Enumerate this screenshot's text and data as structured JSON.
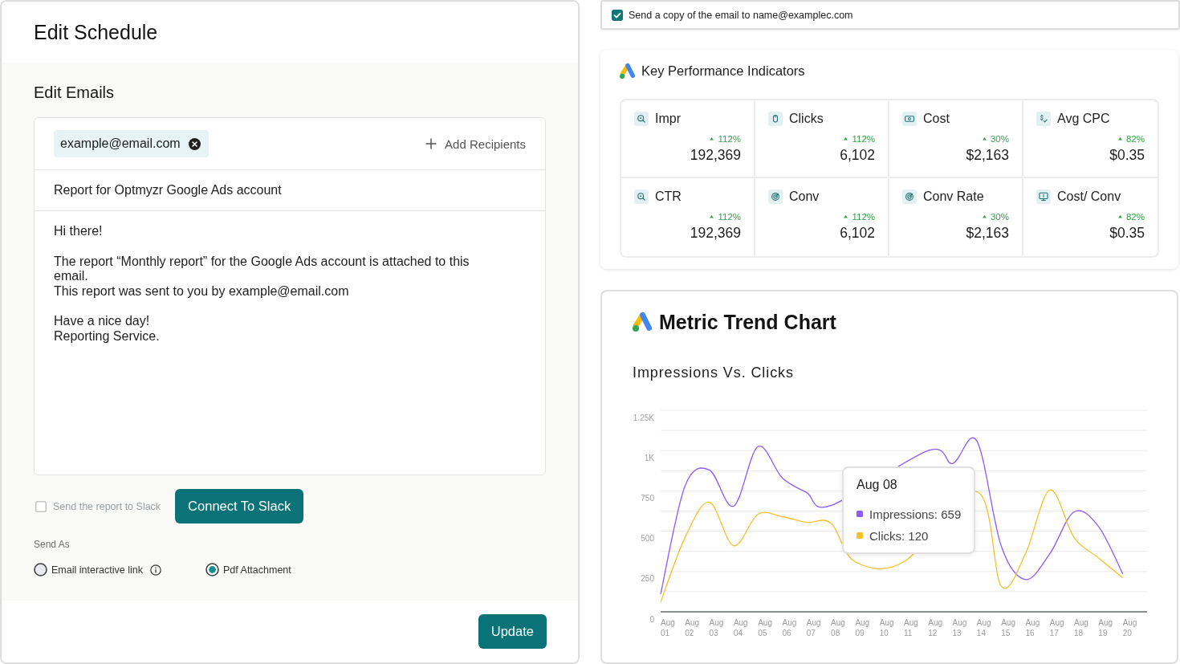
{
  "edit_schedule": {
    "title": "Edit Schedule",
    "section_title": "Edit Emails",
    "recipients": [
      {
        "email": "example@email.com"
      }
    ],
    "add_recipients": "Add Recipients",
    "subject": "Report for Optmyzr Google Ads account",
    "message": {
      "paragraphs": [
        {
          "lines": [
            "Hi there!"
          ]
        },
        {
          "lines": [
            "The report “Monthly report” for the Google Ads account is attached to this",
            "email.",
            "This report was sent to you by example@email.com"
          ]
        },
        {
          "lines": [
            "Have a nice day!",
            "Reporting Service."
          ]
        }
      ]
    },
    "slack": {
      "label": "Send the report to Slack",
      "checked": false,
      "disabled": true
    },
    "slack_button": "Connect To Slack",
    "send_as": {
      "label": "Send As",
      "options": [
        {
          "label": "Email interactive link",
          "selected": false,
          "info": true
        },
        {
          "label": "Pdf Attachment",
          "selected": true,
          "info": false
        }
      ]
    },
    "update_button": "Update"
  },
  "copy_option": {
    "label": "Send a copy of the email to name@examplec.com",
    "checked": true
  },
  "kpi_panel": {
    "title": "Key Performance Indicators",
    "metrics": [
      {
        "kind": "impressions",
        "label": "Impr",
        "rising": true,
        "change": "112%",
        "value": "192,369"
      },
      {
        "kind": "clicks",
        "label": "Clicks",
        "rising": true,
        "change": "112%",
        "value": "6,102"
      },
      {
        "kind": "cost",
        "label": "Cost",
        "rising": true,
        "change": "30%",
        "value": "$2,163"
      },
      {
        "kind": "cpc",
        "label": "Avg CPC",
        "rising": true,
        "change": "82%",
        "value": "$0.35"
      },
      {
        "kind": "ctr",
        "label": "CTR",
        "rising": true,
        "change": "112%",
        "value": "192,369"
      },
      {
        "kind": "conversions",
        "label": "Conv",
        "rising": true,
        "change": "112%",
        "value": "6,102"
      },
      {
        "kind": "rate",
        "label": "Conv Rate",
        "rising": true,
        "change": "30%",
        "value": "$2,163"
      },
      {
        "kind": "costconv",
        "label": "Cost/ Conv",
        "rising": true,
        "change": "82%",
        "value": "$0.35"
      }
    ]
  },
  "trend_chart": {
    "title": "Metric Trend Chart",
    "chart_data": {
      "type": "line",
      "title": "Impressions Vs. Clicks",
      "categories": [
        "Aug 01",
        "Aug 02",
        "Aug 03",
        "Aug 04",
        "Aug 05",
        "Aug 06",
        "Aug 07",
        "Aug 08",
        "Aug 09",
        "Aug 10",
        "Aug 11",
        "Aug 12",
        "Aug 13",
        "Aug 14",
        "Aug 15",
        "Aug 16",
        "Aug 17",
        "Aug 18",
        "Aug 19",
        "Aug 20"
      ],
      "series": [
        {
          "color": "#8b5cf6",
          "values": [
            110,
            780,
            880,
            655,
            1025,
            830,
            740,
            659,
            null,
            null,
            null,
            1000,
            920,
            1060,
            410,
            200,
            360,
            620,
            530,
            235
          ]
        },
        {
          "color": "#f5c02a",
          "values": [
            60,
            460,
            680,
            410,
            605,
            590,
            555,
            550,
            310,
            null,
            310,
            null,
            null,
            745,
            160,
            360,
            755,
            460,
            335,
            210
          ]
        }
      ],
      "ylim": [
        0,
        1250
      ],
      "yticks": [
        0,
        250,
        500,
        750,
        {
          "value": 1000,
          "label": "1K"
        },
        {
          "value": 1250,
          "label": "1.25K"
        }
      ],
      "grid": true
    },
    "tooltip": {
      "title": "Aug 08",
      "items": [
        {
          "text": "Impressions: 659",
          "color": "#8b5cf6"
        },
        {
          "text": "Clicks: 120",
          "color": "#f5c02a"
        }
      ]
    }
  }
}
